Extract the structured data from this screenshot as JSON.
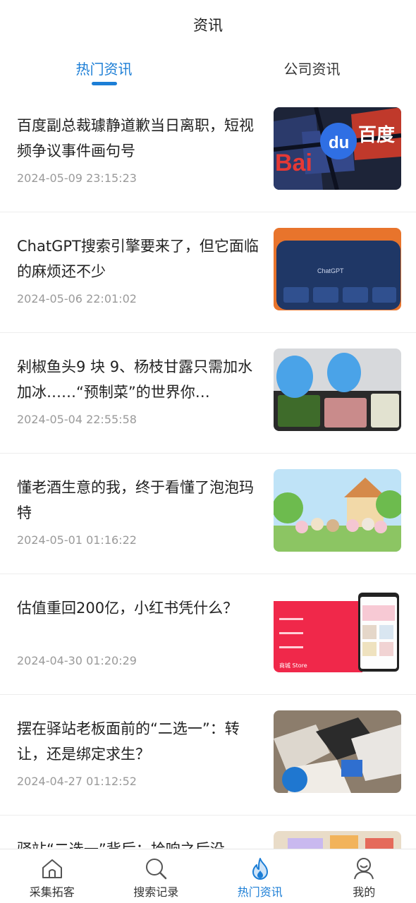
{
  "header": {
    "title": "资讯"
  },
  "tabs": [
    {
      "label": "热门资讯",
      "active": true
    },
    {
      "label": "公司资讯",
      "active": false
    }
  ],
  "articles": [
    {
      "title": "百度副总裁璩静道歉当日离职，短视频争议事件画句号",
      "date": "2024-05-09 23:15:23",
      "thumb": "baidu-logo-image"
    },
    {
      "title": "ChatGPT搜索引擎要来了，但它面临的麻烦还不少",
      "date": "2024-05-06 22:01:02",
      "thumb": "chatgpt-screen-image"
    },
    {
      "title": "剁椒鱼头9 块 9、杨枝甘露只需加水加冰……“预制菜”的世界你…",
      "date": "2024-05-04 22:55:58",
      "thumb": "prepared-food-image"
    },
    {
      "title": "懂老酒生意的我，终于看懂了泡泡玛特",
      "date": "2024-05-01 01:16:22",
      "thumb": "toy-figures-image"
    },
    {
      "title": "估值重回200亿，小红书凭什么？",
      "date": "2024-04-30 01:20:29",
      "thumb": "xiaohongshu-store-image"
    },
    {
      "title": "摆在驿站老板面前的“二选一”：转让，还是绑定求生？",
      "date": "2024-04-27 01:12:52",
      "thumb": "parcels-image"
    },
    {
      "title": "驿站“二选一”背后：拾响之后没",
      "date": "",
      "thumb": "partial-image"
    }
  ],
  "thumb_texts": {
    "baidu": "Bai",
    "baidu_du": "du",
    "baidu_cn": "百度",
    "chatgpt": "ChatGPT",
    "store": "商城 Store"
  },
  "bottom_nav": [
    {
      "label": "采集拓客",
      "icon": "home-icon",
      "active": false
    },
    {
      "label": "搜索记录",
      "icon": "search-icon",
      "active": false
    },
    {
      "label": "热门资讯",
      "icon": "flame-icon",
      "active": true
    },
    {
      "label": "我的",
      "icon": "user-icon",
      "active": false
    }
  ],
  "colors": {
    "accent": "#1c7ed6",
    "text": "#222222",
    "muted": "#9a9a9a"
  }
}
